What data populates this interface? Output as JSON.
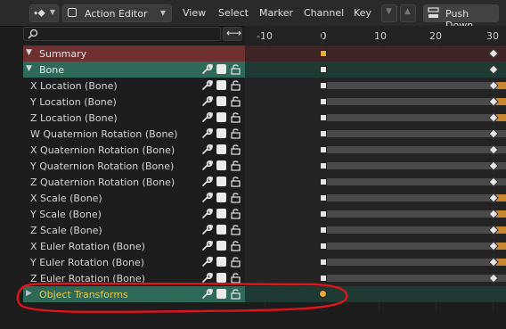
{
  "header": {
    "editor_mode": "Action Editor",
    "menus": [
      "View",
      "Select",
      "Marker",
      "Channel",
      "Key"
    ],
    "push_down_label": "Push Down"
  },
  "ruler": {
    "ticks": [
      "-10",
      "0",
      "10",
      "20",
      "30"
    ],
    "current_frame": "0"
  },
  "channels": {
    "summary": "Summary",
    "group": "Bone",
    "items": [
      "X Location (Bone)",
      "Y Location (Bone)",
      "Z Location (Bone)",
      "W Quaternion Rotation (Bone)",
      "X Quaternion Rotation (Bone)",
      "Y Quaternion Rotation (Bone)",
      "Z Quaternion Rotation (Bone)",
      "X Scale (Bone)",
      "Y Scale (Bone)",
      "Z Scale (Bone)",
      "X Euler Rotation (Bone)",
      "Y Euler Rotation (Bone)",
      "Z Euler Rotation (Bone)"
    ],
    "object_transforms": "Object Transforms"
  },
  "colors": {
    "summary": "#6e3030",
    "group": "#2f6a59",
    "object_label": "#e8c84a",
    "selected_key": "#f0a836",
    "annotation": "#e0141a"
  },
  "icons": [
    "editor-type-icon",
    "action-editor-icon",
    "push-down-icon",
    "search-icon",
    "swap-icon",
    "wrench-icon",
    "checkbox-icon",
    "lock-icon"
  ]
}
